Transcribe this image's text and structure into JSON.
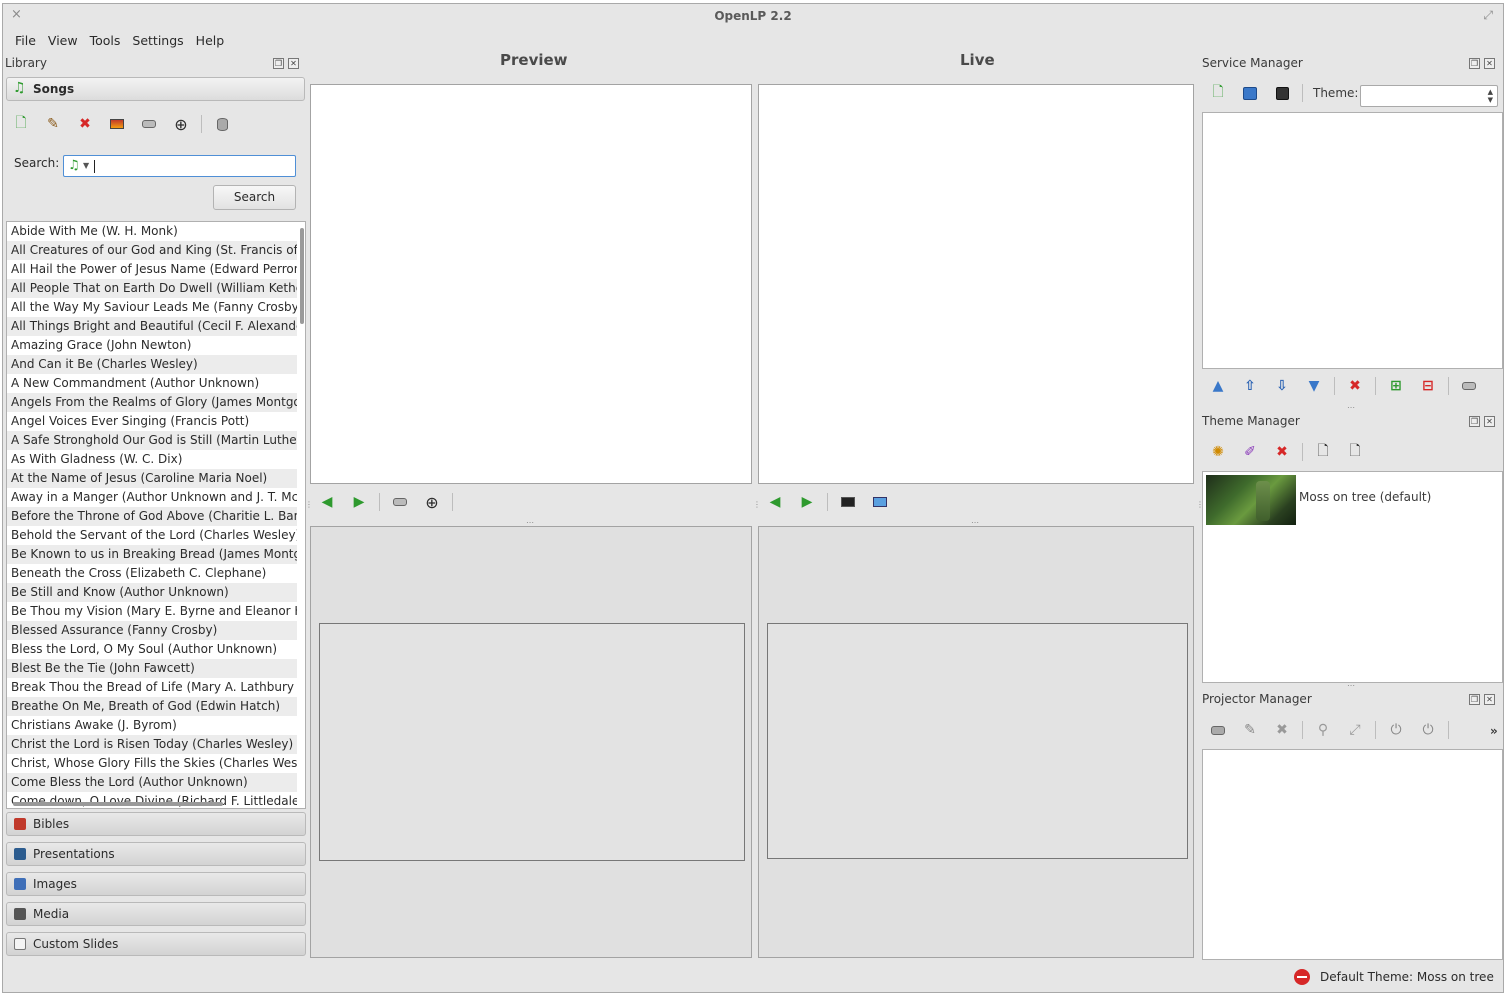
{
  "window": {
    "title": "OpenLP 2.2",
    "close_glyph": "×",
    "max_glyph": "⤢"
  },
  "menu": [
    "File",
    "View",
    "Tools",
    "Settings",
    "Help"
  ],
  "library": {
    "title": "Library",
    "songs_label": "Songs",
    "search_label": "Search:",
    "search_button": "Search",
    "search_value": "",
    "songs": [
      "Abide With Me (W. H. Monk)",
      "All Creatures of our God and King (St. Francis of Assisi)",
      "All Hail the Power of Jesus Name (Edward Perronet)",
      "All People That on Earth Do Dwell (William Kethe)",
      "All the Way My Saviour Leads Me (Fanny Crosby)",
      "All Things Bright and Beautiful (Cecil F. Alexander)",
      "Amazing Grace (John Newton)",
      "And Can it Be (Charles Wesley)",
      "A New Commandment (Author Unknown)",
      "Angels From the Realms of Glory (James Montgomery)",
      "Angel Voices Ever Singing (Francis Pott)",
      "A Safe Stronghold Our God is Still (Martin Luther)",
      "As With Gladness (W. C. Dix)",
      "At the Name of Jesus (Caroline Maria Noel)",
      "Away in a Manger (Author Unknown and J. T. McFarland)",
      "Before the Throne of God Above (Charitie L. Bancroft)",
      "Behold the Servant of the Lord (Charles Wesley)",
      "Be Known to us in Breaking Bread (James Montgomery)",
      "Beneath the Cross (Elizabeth C. Clephane)",
      "Be Still and Know (Author Unknown)",
      "Be Thou my Vision (Mary E. Byrne and Eleanor H. Hull)",
      "Blessed Assurance (Fanny Crosby)",
      "Bless the Lord, O My Soul (Author Unknown)",
      "Blest Be the Tie (John Fawcett)",
      "Break Thou the Bread of Life (Mary A. Lathbury and A. Groves)",
      "Breathe On Me, Breath of God (Edwin Hatch)",
      "Christians Awake (J. Byrom)",
      "Christ the Lord is Risen Today (Charles Wesley)",
      "Christ, Whose Glory Fills the Skies (Charles Wesley)",
      "Come Bless the Lord (Author Unknown)",
      "Come down, O Love Divine (Richard F. Littledale)"
    ],
    "plugins": [
      "Bibles",
      "Presentations",
      "Images",
      "Media",
      "Custom Slides"
    ],
    "plugin_colors": [
      "#c0392b",
      "#2c5c8f",
      "#3f6fb8",
      "#555555",
      "#f4f4f4"
    ]
  },
  "preview": {
    "title": "Preview"
  },
  "live": {
    "title": "Live"
  },
  "service_manager": {
    "title": "Service Manager",
    "theme_label": "Theme:",
    "theme_value": ""
  },
  "theme_manager": {
    "title": "Theme Manager",
    "themes": [
      {
        "name": "Moss on tree (default)"
      }
    ]
  },
  "projector_manager": {
    "title": "Projector Manager",
    "more_glyph": "»"
  },
  "status": {
    "text": "Default Theme: Moss on tree"
  }
}
